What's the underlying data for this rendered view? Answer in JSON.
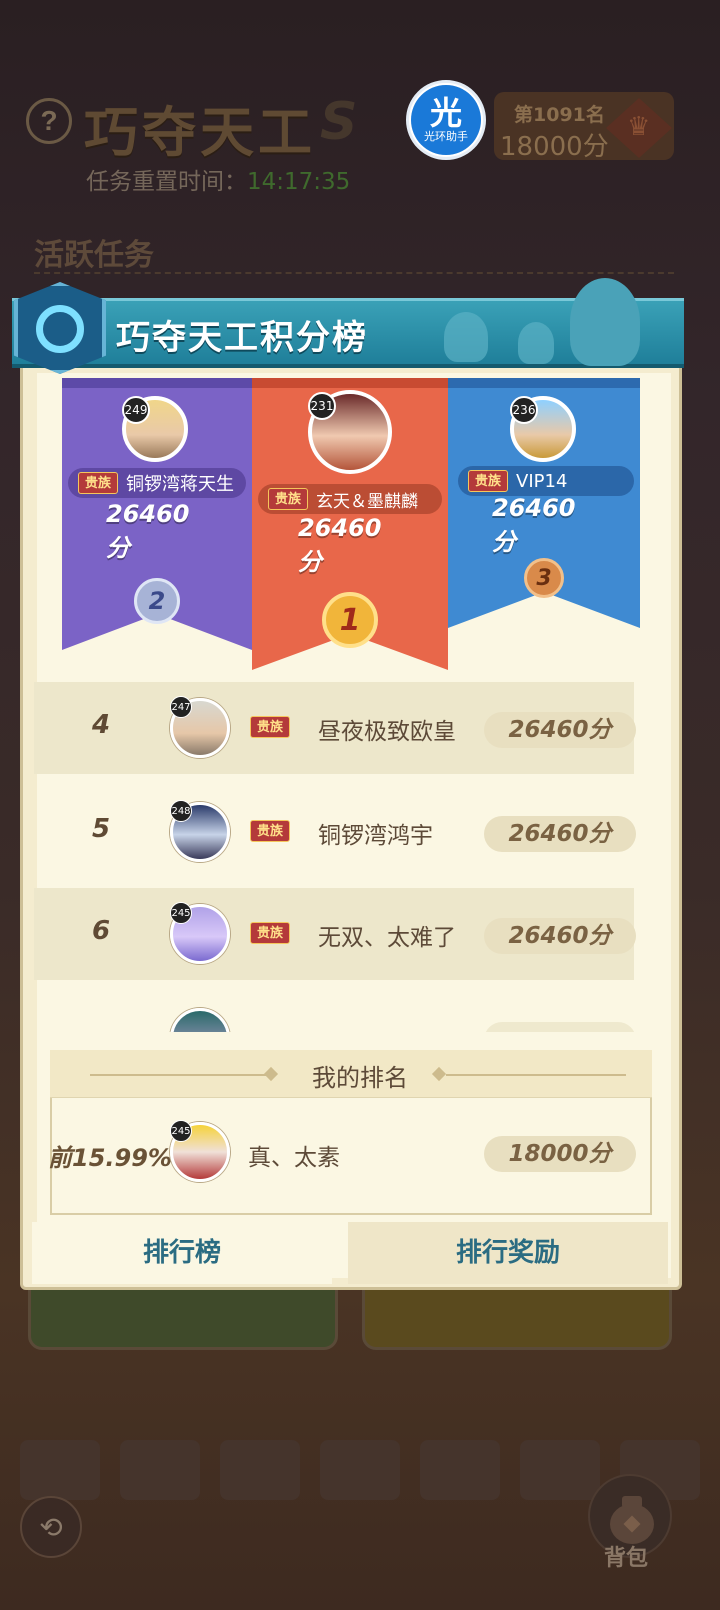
{
  "background": {
    "game_title": "巧夺天工",
    "reset_label": "任务重置时间：",
    "reset_time": "14:17:35",
    "my_rank_label": "第1091名",
    "my_score_label": "18000分",
    "section_title": "活跃任务",
    "logo_text": "光环助手",
    "logo_glyph": "光"
  },
  "leaderboard": {
    "title": "巧夺天工积分榜",
    "top3": [
      {
        "rank": "1",
        "level": "231",
        "name": "玄天＆墨麒麟",
        "score": "26460分",
        "badge": "贵族"
      },
      {
        "rank": "2",
        "level": "249",
        "name": "铜锣湾蒋天生",
        "score": "26460分",
        "badge": "贵族"
      },
      {
        "rank": "3",
        "level": "236",
        "name": "VIP14",
        "score": "26460分",
        "badge": "贵族"
      }
    ],
    "rows": [
      {
        "rank": "4",
        "level": "247",
        "name": "昼夜极致欧皇",
        "score": "26460分",
        "badge": "贵族"
      },
      {
        "rank": "5",
        "level": "248",
        "name": "铜锣湾鸿宇",
        "score": "26460分",
        "badge": "贵族"
      },
      {
        "rank": "6",
        "level": "245",
        "name": "无双、太难了",
        "score": "26460分",
        "badge": "贵族"
      }
    ]
  },
  "my_rank": {
    "title": "我的排名",
    "percent": "前15.99%",
    "level": "245",
    "name": "真、太素",
    "score": "18000分"
  },
  "tabs": {
    "active": "排行榜",
    "inactive": "排行奖励"
  },
  "bottom": {
    "bag_label": "背包"
  },
  "colors": {
    "ribbon_1": "#e8674a",
    "ribbon_2": "#7b63c6",
    "ribbon_3": "#3f8ad2",
    "header": "#2a8ea8",
    "panel": "#fbf7e3"
  }
}
